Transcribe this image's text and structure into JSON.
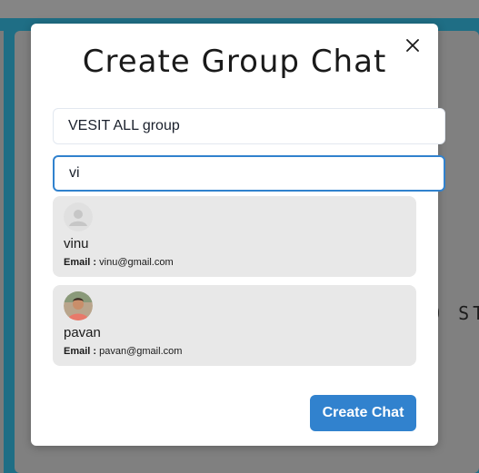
{
  "background": {
    "partial_text": "O ST"
  },
  "modal": {
    "title": "Create Group Chat",
    "chat_name_value": "VESIT ALL group",
    "search_value": "vi",
    "create_button_label": "Create Chat",
    "users": [
      {
        "name": "vinu",
        "email_label": "Email :",
        "email": "vinu@gmail.com",
        "avatar": "default-avatar-icon"
      },
      {
        "name": "pavan",
        "email_label": "Email :",
        "email": "pavan@gmail.com",
        "avatar": "profile-photo"
      }
    ]
  },
  "colors": {
    "accent": "#3182ce",
    "card_bg": "#e8e8e8",
    "teal_frame": "#1f6e85"
  }
}
